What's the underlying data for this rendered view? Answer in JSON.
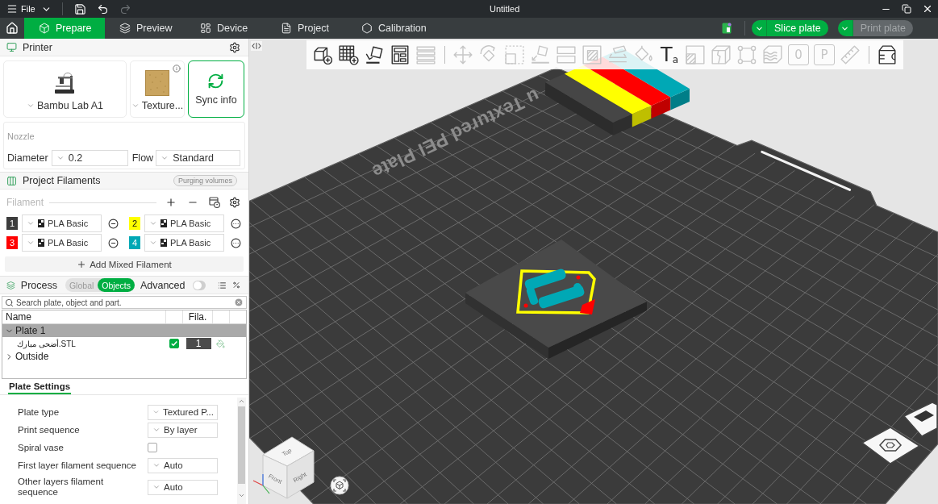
{
  "title_bar": {
    "menu_label": "File",
    "quick_actions": [
      {
        "kind": "save",
        "disabled": false
      },
      {
        "kind": "undo",
        "disabled": false
      },
      {
        "kind": "redo",
        "disabled": true
      }
    ],
    "title": "Untitled"
  },
  "tabs": [
    {
      "kind": "prepare",
      "label": "Prepare",
      "selected": true
    },
    {
      "kind": "preview",
      "label": "Preview",
      "selected": false
    },
    {
      "kind": "device",
      "label": "Device",
      "selected": false
    },
    {
      "kind": "project",
      "label": "Project",
      "selected": false
    },
    {
      "kind": "calibration",
      "label": "Calibration",
      "selected": false
    }
  ],
  "actions": [
    {
      "label": "Slice plate",
      "disabled": false
    },
    {
      "label": "Print plate",
      "disabled": true
    }
  ],
  "printer": {
    "title": "Printer",
    "printer_name": "Bambu Lab A1",
    "plate_name": "Texture...",
    "sync_label": "Sync info",
    "nozzle_label": "Nozzle",
    "diameter_label": "Diameter",
    "diameter": "0.2",
    "flow_label": "Flow",
    "flow": "Standard"
  },
  "filaments": {
    "title": "Project Filaments",
    "purge_button": "Purging volumes",
    "list_label": "Filament",
    "items": [
      {
        "number": "1",
        "color": "#3d3d3d",
        "type": "PLA Basic"
      },
      {
        "number": "2",
        "color": "#ffff00",
        "type": "PLA Basic"
      },
      {
        "number": "3",
        "color": "#ff0000",
        "type": "PLA Basic"
      },
      {
        "number": "4",
        "color": "#00a8b5",
        "type": "PLA Basic"
      }
    ],
    "add_button": "Add Mixed Filament"
  },
  "process": {
    "title": "Process",
    "modes": [
      {
        "label": "Global",
        "selected": false
      },
      {
        "label": "Objects",
        "selected": true
      }
    ],
    "advanced_label": "Advanced",
    "advanced_on": false,
    "search": {
      "placeholder": "Search plate, object and part."
    },
    "columns": [
      "Name",
      "Fila."
    ],
    "tree": [
      {
        "label": "Plate 1",
        "expanded": true,
        "selected": true,
        "children": [
          {
            "label": "أضحى مبارك.STL",
            "checked": true,
            "filament": "1"
          }
        ]
      },
      {
        "label": "Outside",
        "expanded": false,
        "selected": false
      }
    ]
  },
  "plate_settings": {
    "tab": {
      "label": "Plate Settings",
      "selected": true
    },
    "rows": [
      {
        "kind": "dropdown",
        "label": "Plate type",
        "value": "Textured P..."
      },
      {
        "kind": "dropdown",
        "label": "Print sequence",
        "value": "By layer"
      },
      {
        "kind": "checkbox",
        "label": "Spiral vase",
        "checked": false
      },
      {
        "kind": "dropdown",
        "label": "First layer filament sequence",
        "value": "Auto"
      },
      {
        "kind": "dropdown",
        "label": "Other layers filament sequence",
        "value": "Auto"
      }
    ]
  },
  "viewport": {
    "tools": [
      {
        "kind": "add-object",
        "disabled": false
      },
      {
        "kind": "add-plate",
        "disabled": false
      },
      {
        "kind": "auto-orient",
        "disabled": false
      },
      {
        "kind": "arrange",
        "disabled": false
      },
      {
        "kind": "layers",
        "disabled": true
      },
      {
        "kind": "separator"
      },
      {
        "kind": "move",
        "disabled": true
      },
      {
        "kind": "rotate",
        "disabled": true
      },
      {
        "kind": "scale",
        "disabled": true
      },
      {
        "kind": "lay-on-face",
        "disabled": true
      },
      {
        "kind": "split",
        "disabled": true
      },
      {
        "kind": "boolean",
        "disabled": true
      },
      {
        "kind": "cut",
        "disabled": true
      },
      {
        "kind": "paint",
        "disabled": true
      },
      {
        "kind": "text",
        "glyph": "T$_{a}$",
        "disabled": false
      },
      {
        "kind": "supports",
        "disabled": true
      },
      {
        "kind": "seam",
        "disabled": true
      },
      {
        "kind": "measure-corners",
        "disabled": true
      },
      {
        "kind": "fuzzy",
        "disabled": true
      },
      {
        "kind": "boxed-glyph",
        "glyph": "0",
        "disabled": true
      },
      {
        "kind": "boxed-glyph",
        "glyph": "P",
        "disabled": true
      },
      {
        "kind": "ruler",
        "disabled": true
      },
      {
        "kind": "separator"
      },
      {
        "kind": "assembly",
        "disabled": false
      }
    ],
    "plate_label": "u Textured PEI Plate",
    "view_cube_faces": [
      "Top",
      "Front",
      "Right"
    ]
  }
}
